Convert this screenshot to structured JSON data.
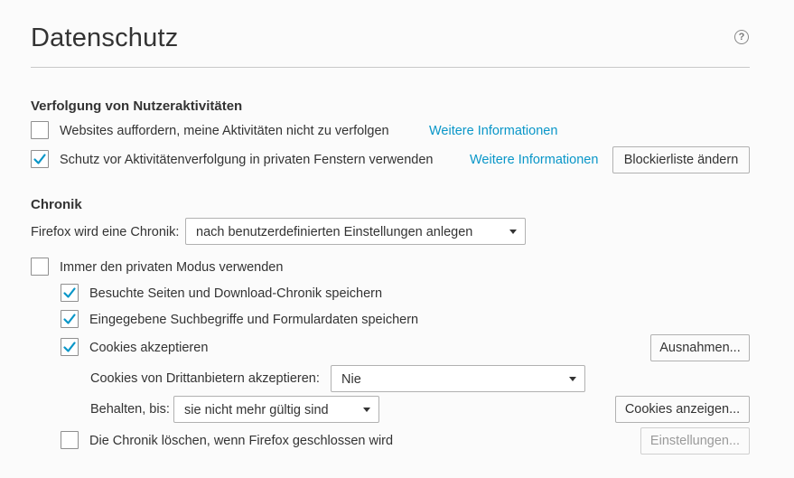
{
  "header": {
    "title": "Datenschutz",
    "help_glyph": "?"
  },
  "tracking": {
    "heading": "Verfolgung von Nutzeraktivitäten",
    "dnt_label": "Websites auffordern, meine Aktivitäten nicht zu verfolgen",
    "dnt_checked": false,
    "dnt_link": "Weitere Informationen",
    "tp_label": "Schutz vor Aktivitätenverfolgung in privaten Fenstern verwenden",
    "tp_checked": true,
    "tp_link": "Weitere Informationen",
    "blocklist_button": "Blockierliste ändern"
  },
  "history": {
    "heading": "Chronik",
    "mode_label": "Firefox wird eine Chronik:",
    "mode_value": "nach benutzerdefinierten Einstellungen anlegen",
    "private_mode_label": "Immer den privaten Modus verwenden",
    "private_mode_checked": false,
    "visited_label": "Besuchte Seiten und Download-Chronik speichern",
    "visited_checked": true,
    "search_label": "Eingegebene Suchbegriffe und Formulardaten speichern",
    "search_checked": true,
    "cookies_label": "Cookies akzeptieren",
    "cookies_checked": true,
    "exceptions_button": "Ausnahmen...",
    "third_party_label": "Cookies von Drittanbietern akzeptieren:",
    "third_party_value": "Nie",
    "keep_label": "Behalten, bis:",
    "keep_value": "sie nicht mehr gültig sind",
    "show_cookies_button": "Cookies anzeigen...",
    "clear_on_close_label": "Die Chronik löschen, wenn Firefox geschlossen wird",
    "clear_on_close_checked": false,
    "settings_button": "Einstellungen..."
  },
  "colors": {
    "accent_link": "#0996c8",
    "checkmark": "#0996c8"
  }
}
